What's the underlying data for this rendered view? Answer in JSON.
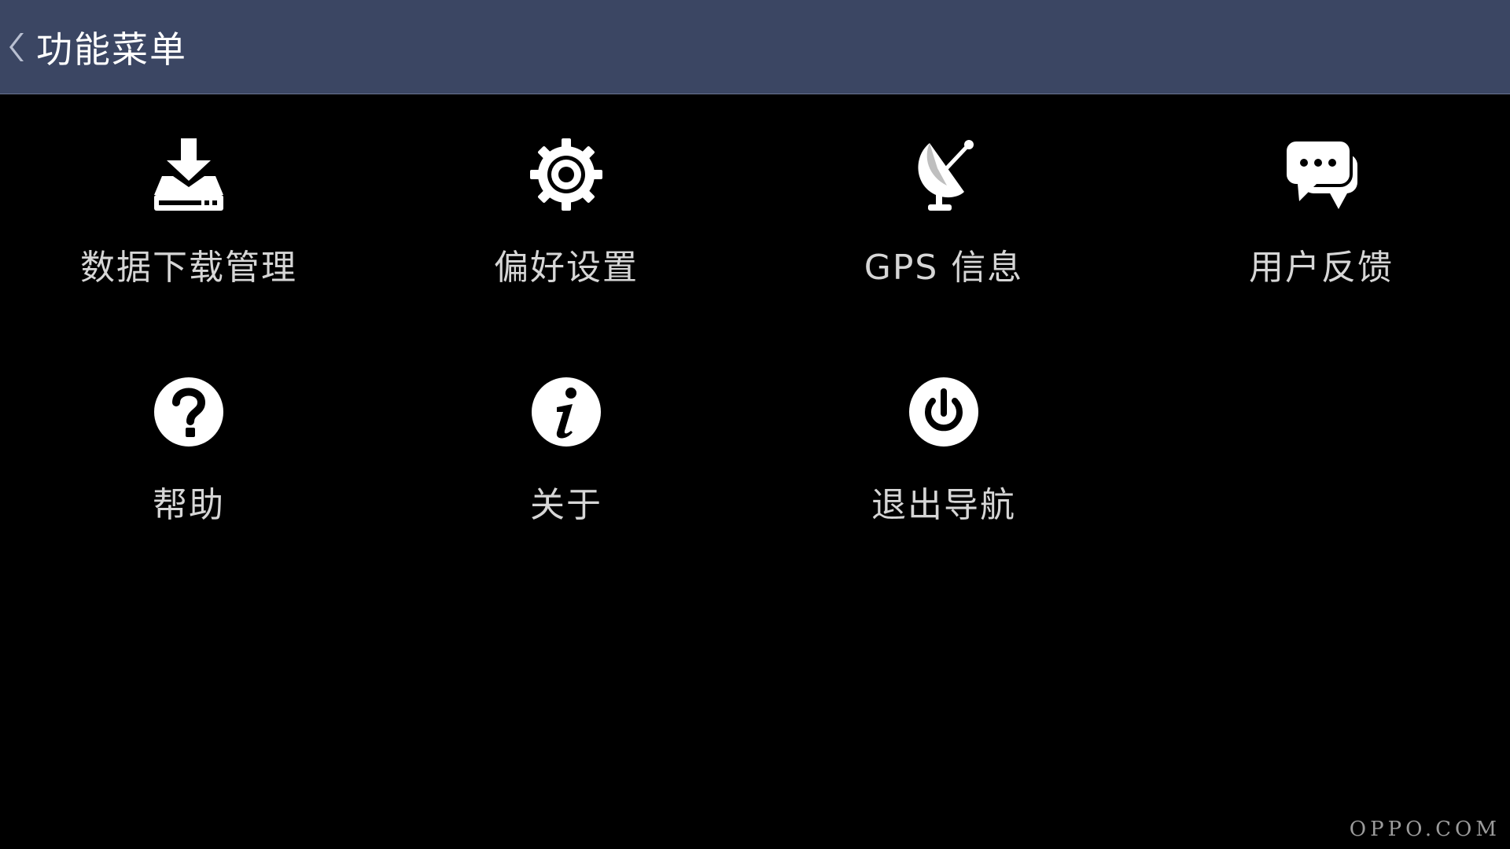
{
  "header": {
    "back_icon": "chevron-left-icon",
    "title": "功能菜单",
    "background_color": "#3b4663"
  },
  "menu": {
    "items": [
      {
        "label": "数据下载管理",
        "icon": "download-tray-icon"
      },
      {
        "label": "偏好设置",
        "icon": "gear-icon"
      },
      {
        "label": "GPS 信息",
        "icon": "satellite-dish-icon"
      },
      {
        "label": "用户反馈",
        "icon": "chat-bubbles-icon"
      },
      {
        "label": "帮助",
        "icon": "help-circle-icon"
      },
      {
        "label": "关于",
        "icon": "info-circle-icon"
      },
      {
        "label": "退出导航",
        "icon": "power-icon"
      }
    ]
  },
  "brand": {
    "text": "OPPO.COM"
  }
}
